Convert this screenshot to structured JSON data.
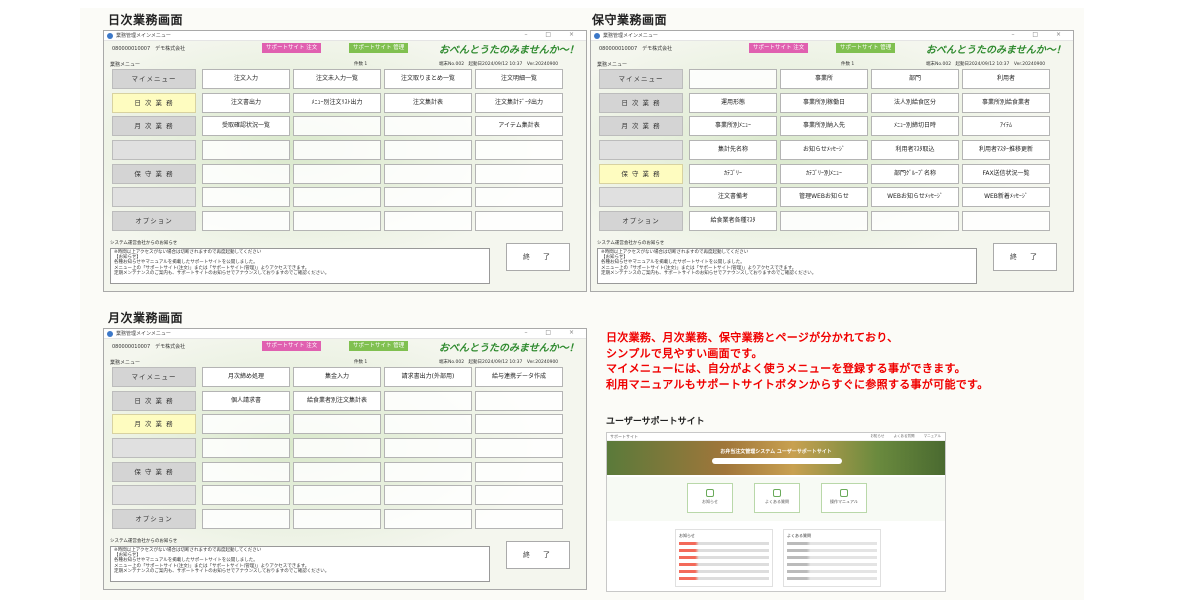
{
  "panels": {
    "daily": {
      "title": "日次業務画面"
    },
    "maint": {
      "title": "保守業務画面"
    },
    "monthly": {
      "title": "月次業務画面"
    }
  },
  "window": {
    "app_title": "業務管理メインメニュー",
    "company": "080000010007　デモ株式会社",
    "support_note": "サポートサイト 注文",
    "support_admin": "サポートサイト 管理",
    "slogan": "おべんとうたのみませんか〜！",
    "menu_label": "業務メニュー",
    "status_count": "件数 1",
    "status_info_a": "端末No.002　起動日2024/09/12 10:37　Ver.20240900",
    "status_info_b": "端末No.002　起動日2024/09/12 10:37　Ver.20240900",
    "exit_label": "終　了",
    "notice_head": "システム運営会社からのお知らせ",
    "notice_lines": [
      "※時間以上アクセスがない場合は切断されますので再度起動してください",
      "【お知らせ】",
      "各種お知らせやマニュアルを掲載したサポートサイトを公開しました。",
      "メニュー上の「サポートサイト(注文)」または「サポートサイト(管理)」よりアクセスできます。",
      "定期メンテナンスのご案内も、サポートサイトのお知らせでアナウンスしておりますのでご確認ください。"
    ]
  },
  "daily": {
    "sidebar": [
      "マイメニュー",
      "日 次 業 務",
      "月 次 業 務",
      "",
      "保 守 業 務",
      "",
      "オプション"
    ],
    "cells": [
      "注文入力",
      "注文未入力一覧",
      "注文取りまとめ一覧",
      "注文明細一覧",
      "注文書出力",
      "ﾒﾆｭｰ別注文ﾘｽﾄ出力",
      "注文集計表",
      "注文集計ﾃﾞｰﾀ出力",
      "受取確認状況一覧",
      "",
      "",
      "アイテム集計表",
      "",
      "",
      "",
      "",
      "",
      "",
      "",
      "",
      "",
      "",
      "",
      "",
      "",
      "",
      "",
      ""
    ]
  },
  "maint": {
    "sidebar": [
      "マイメニュー",
      "日 次 業 務",
      "月 次 業 務",
      "",
      "保 守 業 務",
      "",
      "オプション"
    ],
    "cells": [
      "",
      "事業所",
      "部門",
      "利用者",
      "運用形態",
      "事業所別稼働日",
      "法人別給食区分",
      "事業所別給食業者",
      "事業所別ﾒﾆｭｰ",
      "事業所別納入先",
      "ﾒﾆｭｰ別締切日時",
      "ｱｲﾃﾑ",
      "集計先名称",
      "お知らせﾒｯｾｰｼﾞ",
      "利用者ﾏｽﾀ取込",
      "利用者ﾏｽﾀｰ推移更新",
      "ｶﾃｺﾞﾘｰ",
      "ｶﾃｺﾞﾘｰ別ﾒﾆｭｰ",
      "部門ｸﾞﾙｰﾌﾟ名称",
      "FAX送信状況一覧",
      "注文書備考",
      "管理WEBお知らせ",
      "WEBお知らせﾒｯｾｰｼﾞ",
      "WEB新着ﾒｯｾｰｼﾞ",
      "給食業者各種ﾏｽﾀ",
      "",
      "",
      ""
    ]
  },
  "monthly": {
    "sidebar": [
      "マイメニュー",
      "日 次 業 務",
      "月 次 業 務",
      "",
      "保 守 業 務",
      "",
      "オプション"
    ],
    "cells": [
      "月次締め処理",
      "集金入力",
      "請求書出力(外部用)",
      "給与連携データ作成",
      "個人請求書",
      "給食業者別注文集計表",
      "",
      "",
      "",
      "",
      "",
      "",
      "",
      "",
      "",
      "",
      "",
      "",
      "",
      "",
      "",
      "",
      "",
      "",
      "",
      "",
      "",
      ""
    ]
  },
  "description": [
    "日次業務、月次業務、保守業務とページが分かれており、",
    "シンプルで見やすい画面です。",
    "マイメニューには、自分がよく使うメニューを登録する事ができます。",
    "利用マニュアルもサポートサイトボタンからすぐに参照する事が可能です。"
  ],
  "support_site": {
    "heading": "ユーザーサポートサイト",
    "logo": "サポートサイト",
    "nav": "お知らせ よくある質問 マニュアル",
    "hero_title": "お弁当注文管理システム ユーザーサポートサイト",
    "cards": [
      "お知らせ",
      "よくある質問",
      "操作マニュアル"
    ],
    "news_title": "お知らせ",
    "faq_title": "よくある質問"
  },
  "colors": {
    "accent_red": "#f00000",
    "active_yellow": "#fefcc0",
    "pink": "#e060b0",
    "green": "#80c050"
  }
}
